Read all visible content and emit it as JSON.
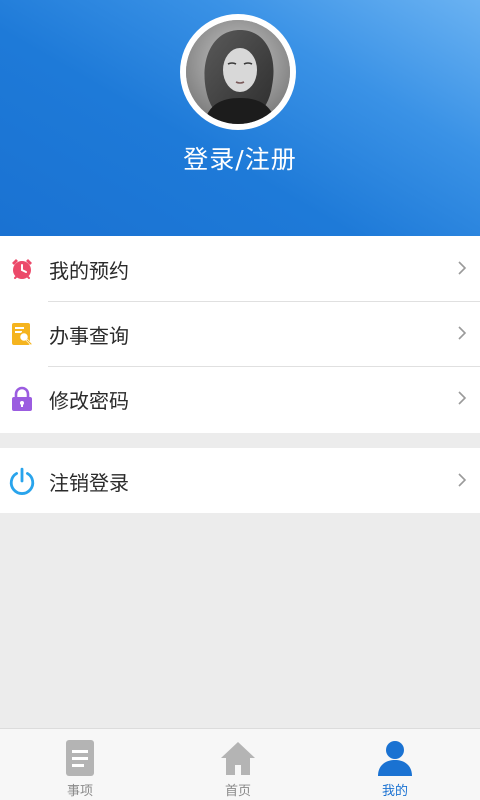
{
  "profile": {
    "login_label": "登录/注册"
  },
  "menu": {
    "items": [
      {
        "label": "我的预约",
        "icon": "alarm-clock-icon"
      },
      {
        "label": "办事查询",
        "icon": "document-search-icon"
      },
      {
        "label": "修改密码",
        "icon": "lock-icon"
      }
    ],
    "logout": {
      "label": "注销登录",
      "icon": "power-icon"
    }
  },
  "bottom_nav": {
    "items": [
      {
        "label": "事项",
        "icon": "document-icon",
        "active": false
      },
      {
        "label": "首页",
        "icon": "home-icon",
        "active": false
      },
      {
        "label": "我的",
        "icon": "person-icon",
        "active": true
      }
    ]
  },
  "colors": {
    "header_blue": "#1a72d2",
    "active_tab": "#1a72d2",
    "alarm_icon": "#ec4a6a",
    "search_icon": "#f5b41e",
    "lock_icon": "#9b5ce0",
    "power_icon": "#29a4ec"
  }
}
